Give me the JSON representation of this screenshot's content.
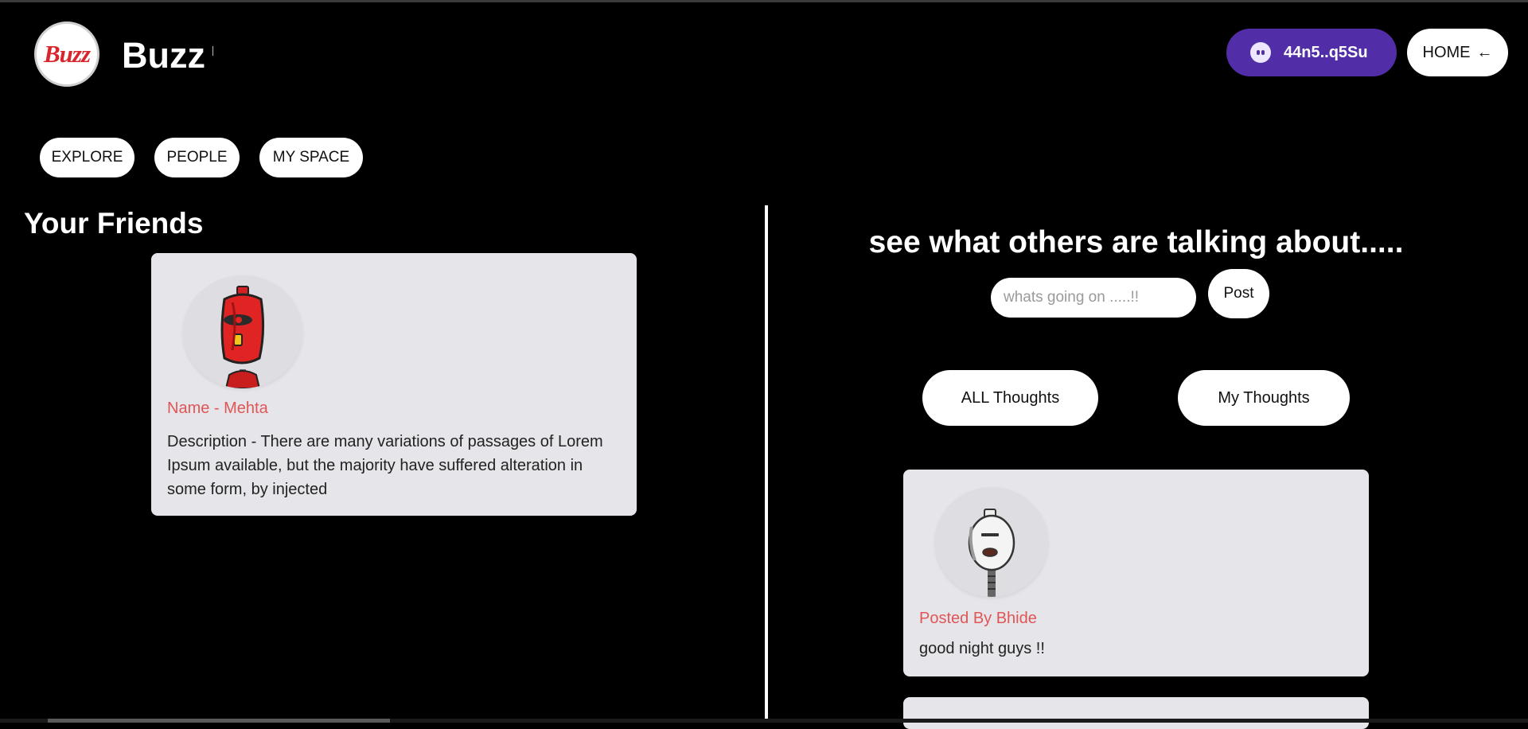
{
  "header": {
    "logo_text": "Buzz",
    "brand": "Buzz",
    "wallet_label": "44n5..q5Su",
    "home_label": "HOME",
    "home_arrow": "←"
  },
  "nav": {
    "explore": "EXPLORE",
    "people": "PEOPLE",
    "my_space": "MY SPACE"
  },
  "friends": {
    "title": "Your Friends",
    "items": [
      {
        "name": "Name - Mehta",
        "description": "Description - There are many variations of passages of Lorem Ipsum available, but the majority have suffered alteration in some form, by injected",
        "avatar": "red-robot-avatar"
      }
    ]
  },
  "feed": {
    "title": "see what others are talking about.....",
    "input_placeholder": "whats going on .....!!",
    "post_label": "Post",
    "filters": [
      "ALL Thoughts",
      "My Thoughts"
    ],
    "posts": [
      {
        "author": "Posted By Bhide",
        "text": "good night guys !!",
        "avatar": "white-robot-avatar"
      }
    ]
  },
  "colors": {
    "background": "#000000",
    "card": "#e5e5ea",
    "accent_name": "#e05656",
    "wallet": "#512da8"
  }
}
